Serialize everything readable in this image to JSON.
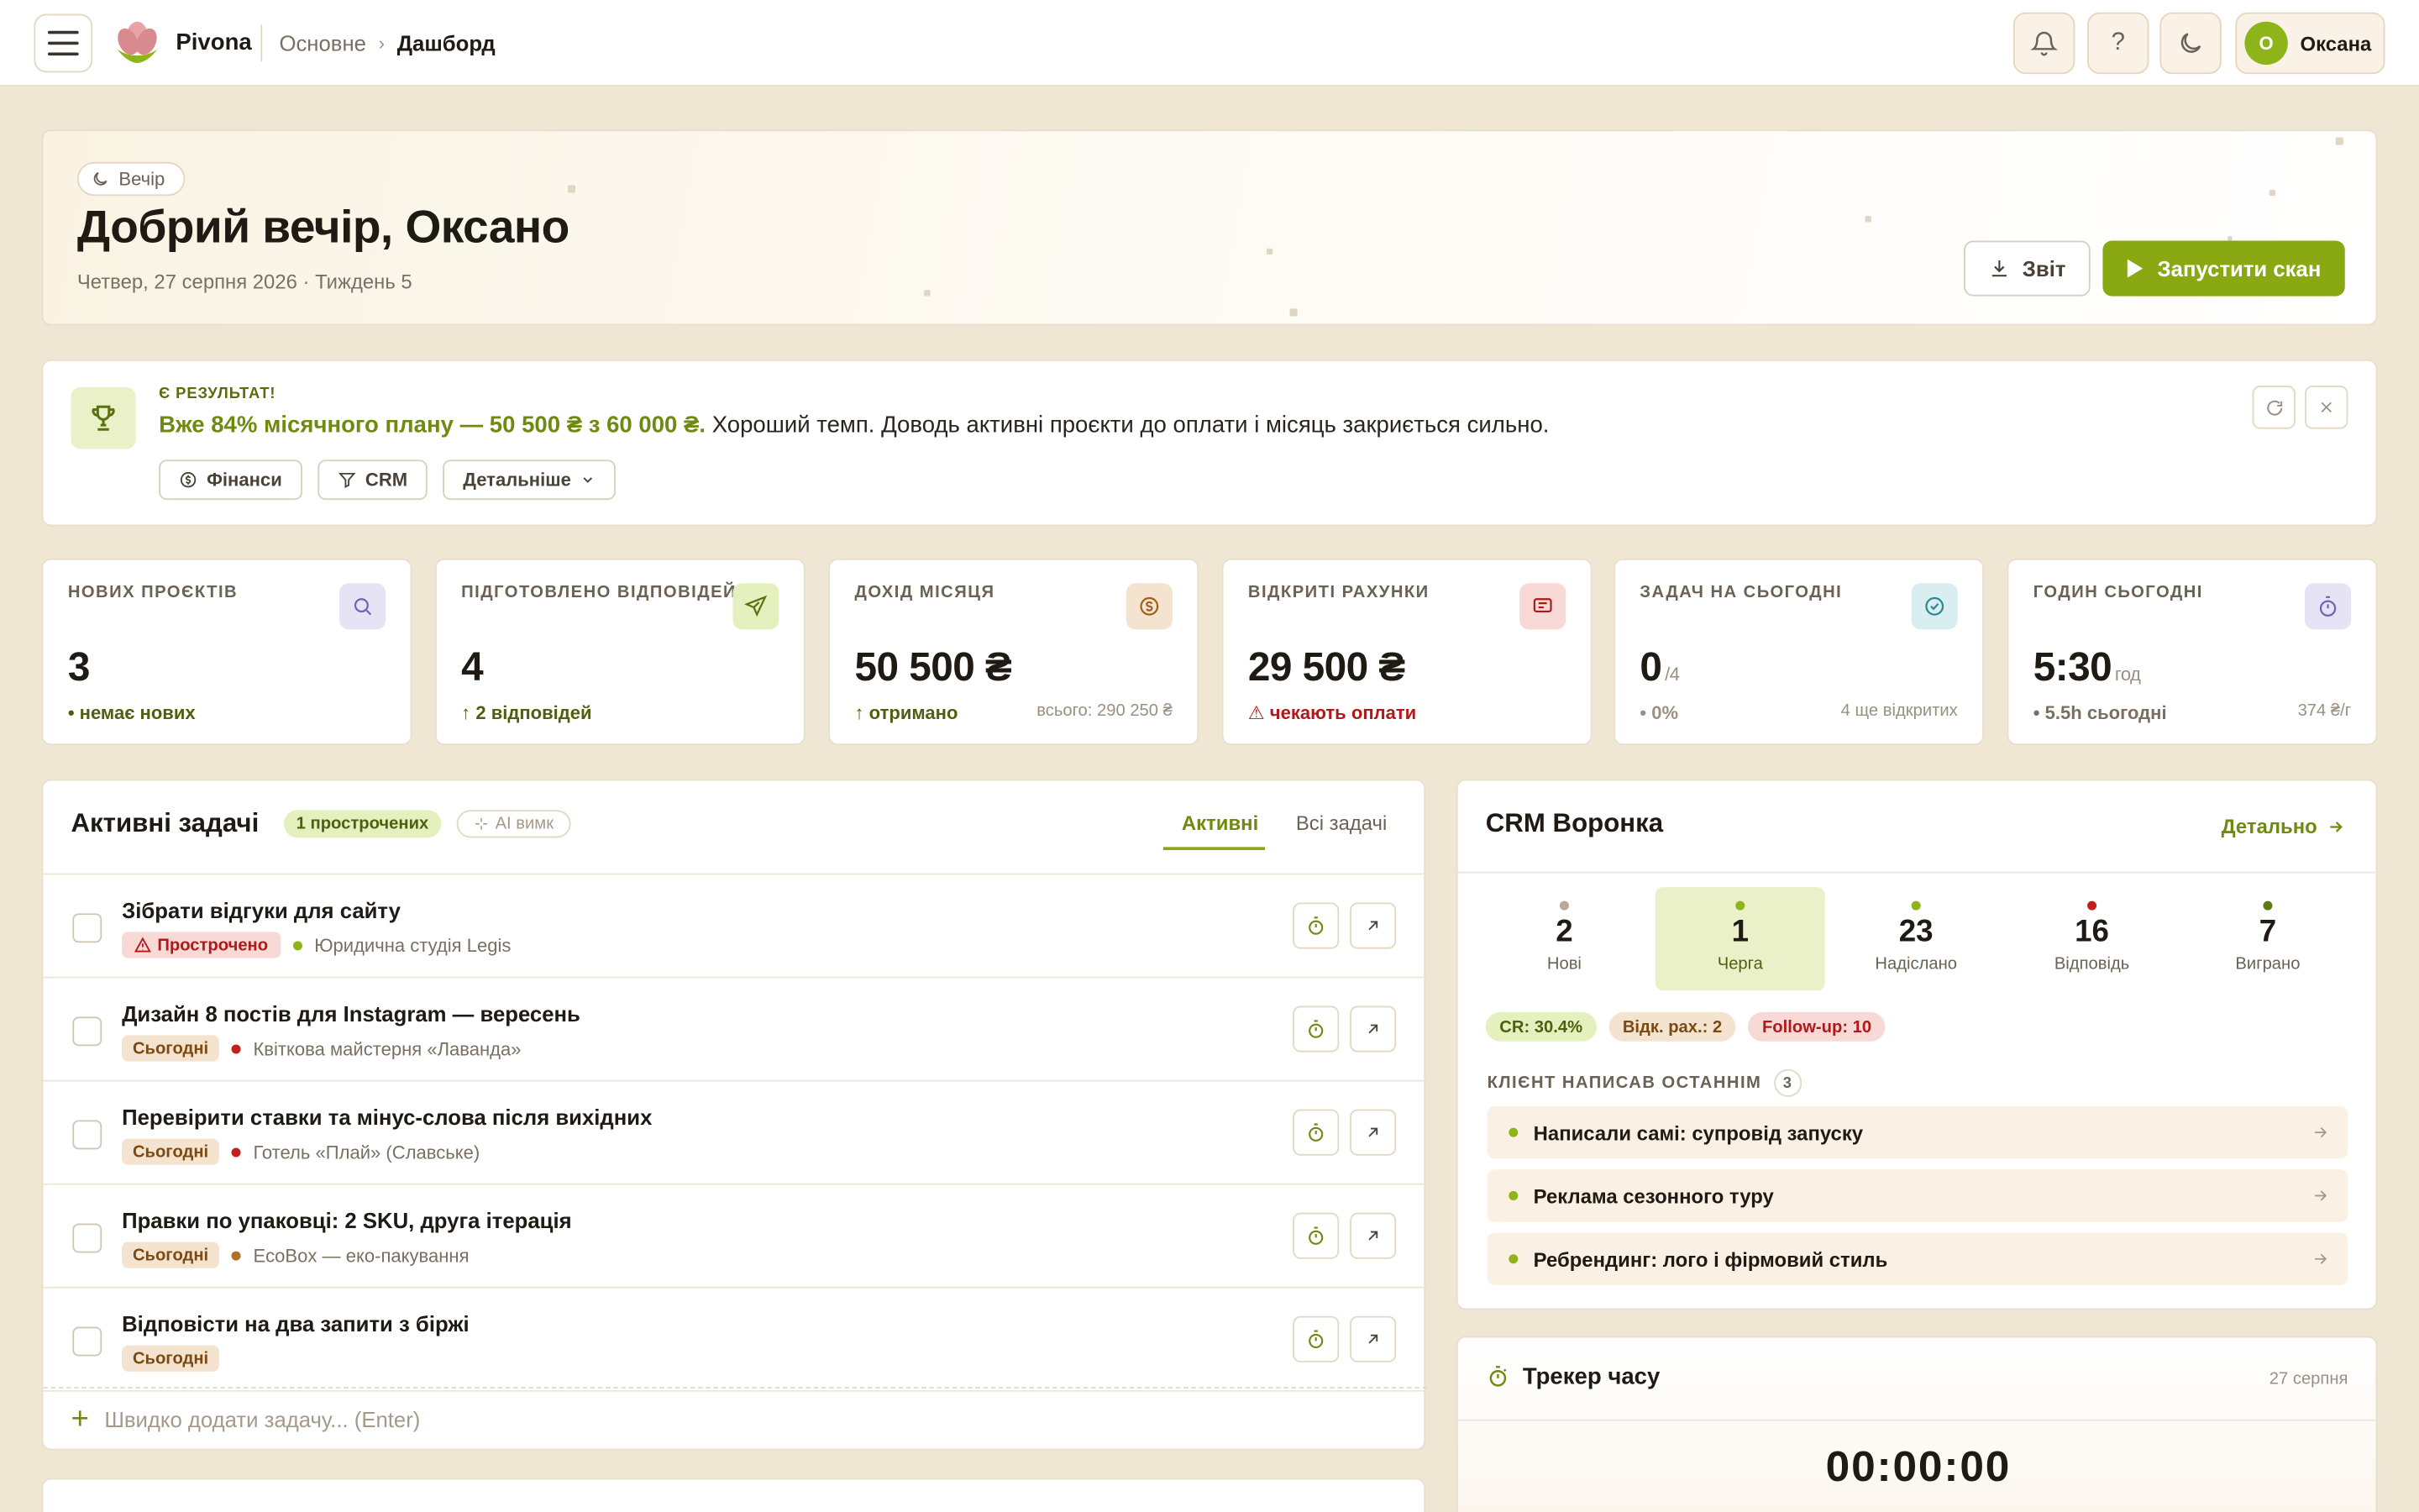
{
  "topbar": {
    "logo_text": "Pivona",
    "breadcrumb": [
      "Основне",
      "Дашборд"
    ],
    "icons": [
      "bell-icon",
      "help-icon",
      "moon-icon"
    ],
    "help_label": "?",
    "user": {
      "initial": "О",
      "name": "Оксана"
    }
  },
  "hero": {
    "chip": "Вечір",
    "title": "Добрий вечір, Оксано",
    "date": "Четвер, 27 серпня 2026 · Тиждень 5",
    "report_btn": "Звіт",
    "scan_btn": "Запустити скан"
  },
  "result": {
    "label": "Є РЕЗУЛЬТАТ!",
    "highlight": "Вже 84% місячного плану — 50 500 ₴ з 60 000 ₴.",
    "text": " Хороший темп. Доводь активні проєкти до оплати і місяць закриється сильно.",
    "actions": [
      "Фінанси",
      "CRM",
      "Детальніше"
    ]
  },
  "stats": [
    {
      "label": "НОВИХ ПРОЄКТІВ",
      "value": "3",
      "unit": "",
      "sub": "• немає нових",
      "side": "",
      "sub_color": "#4d6010",
      "icon": "search-icon",
      "icon_bg": "#e6e3f5",
      "icon_color": "#6b63b5"
    },
    {
      "label": "ПІДГОТОВЛЕНО ВІДПОВІДЕЙ",
      "value": "4",
      "unit": "",
      "sub": "↑ 2 відповідей",
      "side": "",
      "sub_color": "#4d6010",
      "icon": "send-icon",
      "icon_bg": "#e5f0bf",
      "icon_color": "#5b7010"
    },
    {
      "label": "ДОХІД МІСЯЦЯ",
      "value": "50 500 ₴",
      "unit": "",
      "sub": "↑ отримано",
      "side": "всього: 290 250 ₴",
      "sub_color": "#4d6010",
      "icon": "coin-icon",
      "icon_bg": "#f4e3cf",
      "icon_color": "#a0601a"
    },
    {
      "label": "ВІДКРИТІ РАХУНКИ",
      "value": "29 500 ₴",
      "unit": "",
      "sub": "⚠ чекають оплати",
      "side": "",
      "sub_color": "#b0181a",
      "icon": "message-icon",
      "icon_bg": "#f9d9d5",
      "icon_color": "#b0181a"
    },
    {
      "label": "ЗАДАЧ НА СЬОГОДНІ",
      "value": "0",
      "unit": "/4",
      "sub": "• 0%",
      "side": "4 ще відкритих",
      "sub_color": "#9a9082",
      "icon": "check-circle-icon",
      "icon_bg": "#d8eef0",
      "icon_color": "#2a8a94"
    },
    {
      "label": "ГОДИН СЬОГОДНІ",
      "value": "5:30",
      "unit": "год",
      "sub": "• 5.5h сьогодні",
      "side": "374 ₴/г",
      "sub_color": "#7a7062",
      "icon": "stopwatch-icon",
      "icon_bg": "#e6e3f5",
      "icon_color": "#6b63b5"
    }
  ],
  "tasks": {
    "title": "Активні задачі",
    "overdue_badge": "1 прострочених",
    "ai_badge": "AI вимк",
    "tabs": [
      "Активні",
      "Всі задачі"
    ],
    "items": [
      {
        "title": "Зібрати відгуки для сайту",
        "status": "Прострочено",
        "kind": "overdue",
        "client": "Юридична студія Legis",
        "client_color": "#8db51a"
      },
      {
        "title": "Дизайн 8 постів для Instagram — вересень",
        "status": "Сьогодні",
        "kind": "today",
        "client": "Квіткова майстерня «Лаванда»",
        "client_color": "#c0201e"
      },
      {
        "title": "Перевірити ставки та мінус-слова після вихідних",
        "status": "Сьогодні",
        "kind": "today",
        "client": "Готель «Плай» (Славське)",
        "client_color": "#c0201e"
      },
      {
        "title": "Правки по упаковці: 2 SKU, друга ітерація",
        "status": "Сьогодні",
        "kind": "today",
        "client": "EcoBox — еко-пакування",
        "client_color": "#b0702a"
      },
      {
        "title": "Відповісти на два запити з біржі",
        "status": "Сьогодні",
        "kind": "today",
        "client": "",
        "client_color": ""
      }
    ],
    "quick_add": "Швидко додати задачу... (Enter)"
  },
  "crm": {
    "title": "CRM Воронка",
    "link": "Детально",
    "stages": [
      {
        "count": "2",
        "label": "Нові",
        "color": "#b8a898",
        "active": false
      },
      {
        "count": "1",
        "label": "Черга",
        "color": "#8db51a",
        "active": true
      },
      {
        "count": "23",
        "label": "Надіслано",
        "color": "#8db51a",
        "active": false
      },
      {
        "count": "16",
        "label": "Відповідь",
        "color": "#c0201e",
        "active": false
      },
      {
        "count": "7",
        "label": "Виграно",
        "color": "#5b7a10",
        "active": false
      }
    ],
    "pills": [
      "CR: 30.4%",
      "Відк. рах.: 2",
      "Follow-up: 10"
    ],
    "last_label": "КЛІЄНТ НАПИСАВ ОСТАННІМ",
    "last_count": "3",
    "leads": [
      "Написали самі: супровід запуску",
      "Реклама сезонного туру",
      "Ребрендинг: лого і фірмовий стиль"
    ]
  },
  "tracker": {
    "title": "Трекер часу",
    "date": "27 серпня",
    "time": "00:00:00"
  }
}
